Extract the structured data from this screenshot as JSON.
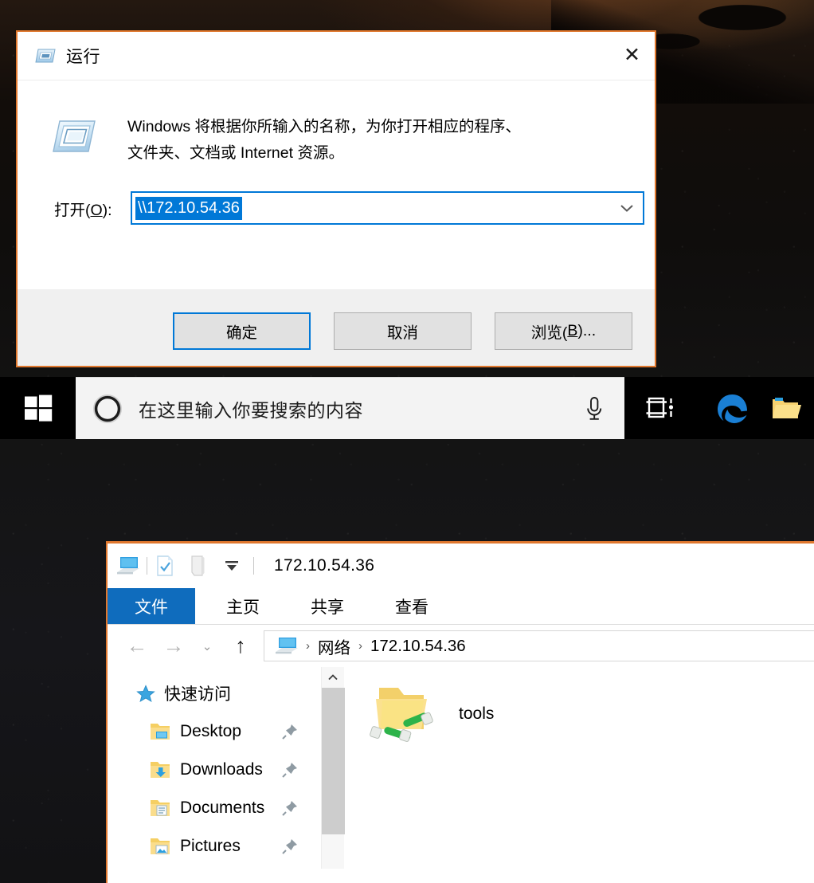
{
  "colors": {
    "dialog_border": "#e0782e",
    "accent_blue": "#0078d7",
    "ribbon_blue": "#0f6cbd",
    "taskbar": "#000000",
    "search_box": "#f3f3f3"
  },
  "run_dialog": {
    "title": "运行",
    "title_icon": "run-window-icon",
    "close_label": "✕",
    "description_icon": "run-large-icon",
    "description_line1": "Windows 将根据你所输入的名称，为你打开相应的程序、",
    "description_line2": "文件夹、文档或 Internet 资源。",
    "open_label_prefix": "打开(",
    "open_label_accel": "O",
    "open_label_suffix": "):",
    "open_value": "\\\\172.10.54.36",
    "dropdown_icon": "chevron-down-icon",
    "buttons": {
      "ok": "确定",
      "cancel": "取消",
      "browse_prefix": "浏览(",
      "browse_accel": "B",
      "browse_suffix": ")..."
    }
  },
  "taskbar": {
    "start_icon": "windows-logo-icon",
    "cortana_icon": "cortana-circle-icon",
    "search_placeholder": "在这里输入你要搜索的内容",
    "mic_icon": "microphone-icon",
    "taskview_icon": "task-view-icon",
    "edge_icon": "edge-browser-icon",
    "explorer_icon": "file-explorer-icon"
  },
  "explorer": {
    "title": "172.10.54.36",
    "qat": {
      "computer_icon": "network-computer-icon",
      "properties_icon": "properties-icon",
      "new_folder_icon": "new-folder-icon",
      "customize_icon": "chevron-down-icon"
    },
    "tabs": [
      {
        "label": "文件",
        "active": true
      },
      {
        "label": "主页",
        "active": false
      },
      {
        "label": "共享",
        "active": false
      },
      {
        "label": "查看",
        "active": false
      }
    ],
    "nav": {
      "back_icon": "arrow-left-icon",
      "forward_icon": "arrow-right-icon",
      "history_icon": "chevron-down-icon",
      "up_icon": "arrow-up-icon"
    },
    "breadcrumb": {
      "icon": "network-computer-icon",
      "items": [
        "网络",
        "172.10.54.36"
      ],
      "separator": "›"
    },
    "sidebar": {
      "header": {
        "label": "快速访问",
        "icon": "star-icon"
      },
      "items": [
        {
          "label": "Desktop",
          "icon": "folder-desktop-icon",
          "pin": "pin-icon"
        },
        {
          "label": "Downloads",
          "icon": "folder-downloads-icon",
          "pin": "pin-icon"
        },
        {
          "label": "Documents",
          "icon": "folder-documents-icon",
          "pin": "pin-icon"
        },
        {
          "label": "Pictures",
          "icon": "folder-pictures-icon",
          "pin": "pin-icon"
        }
      ]
    },
    "scrollbar": {
      "up_icon": "chevron-up-icon"
    },
    "files": [
      {
        "name": "tools",
        "icon": "shared-folder-icon"
      }
    ]
  }
}
